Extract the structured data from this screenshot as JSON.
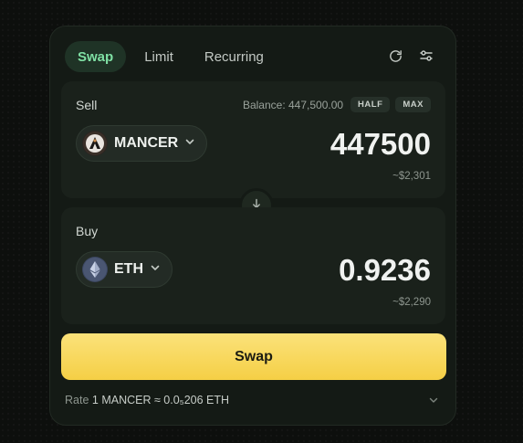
{
  "tabs": [
    {
      "label": "Swap"
    },
    {
      "label": "Limit"
    },
    {
      "label": "Recurring"
    }
  ],
  "sell": {
    "label": "Sell",
    "balance_text": "Balance: 447,500.00",
    "half_label": "HALF",
    "max_label": "MAX",
    "token": "MANCER",
    "amount": "447500",
    "fiat": "~$2,301"
  },
  "buy": {
    "label": "Buy",
    "token": "ETH",
    "amount": "0.9236",
    "fiat": "~$2,290"
  },
  "swap_button": "Swap",
  "rate": {
    "prefix": "Rate",
    "value": "1 MANCER ≈ 0.0₅206 ETH"
  },
  "icons": {
    "refresh": "refresh-icon",
    "settings": "sliders-icon",
    "flip": "arrow-down-icon"
  },
  "colors": {
    "accent_green": "#7fe0a4",
    "swap_yellow": "#f5cf45",
    "card_bg": "#141a15"
  }
}
